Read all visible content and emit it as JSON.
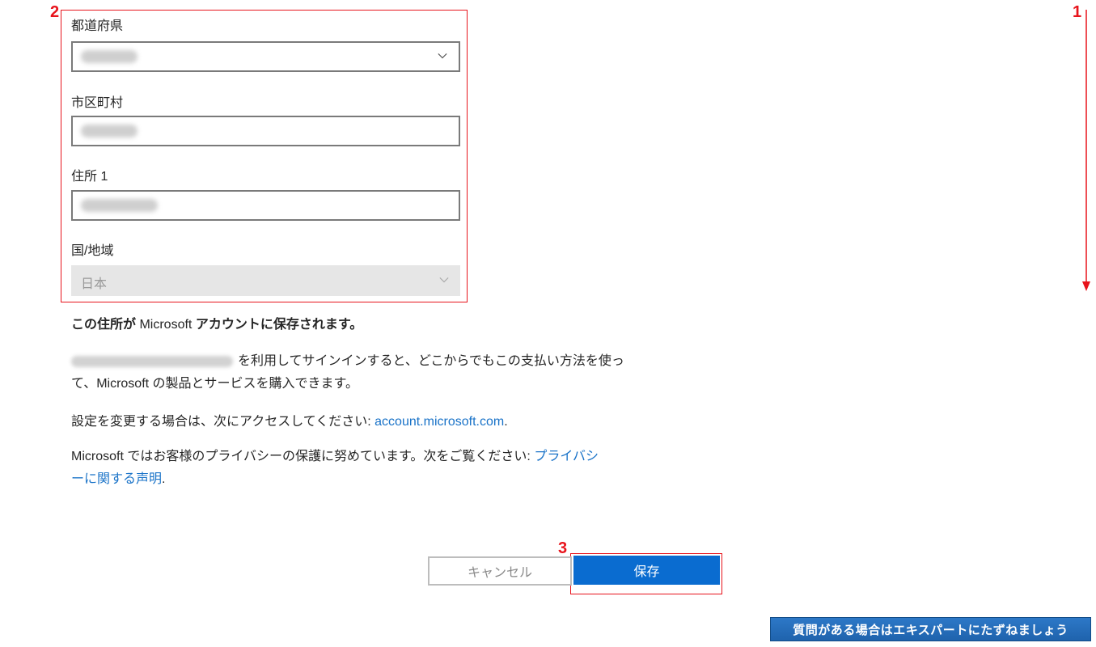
{
  "annotations": {
    "one": "1",
    "two": "2",
    "three": "3",
    "color": "#e8141c"
  },
  "form": {
    "prefecture_label": "都道府県",
    "city_label": "市区町村",
    "address1_label": "住所 1",
    "country_label": "国/地域",
    "country_value": "日本"
  },
  "info": {
    "heading_pre": "この住所が",
    "heading_ms": " Microsoft ",
    "heading_post": "アカウントに保存されます。",
    "signin_line1": "を利用してサインインすると、どこからでもこの支払い方法を使っ",
    "signin_line2": "て、Microsoft の製品とサービスを購入できます。",
    "settings_text": "設定を変更する場合は、次にアクセスしてください: ",
    "settings_link": "account.microsoft.com",
    "privacy_text": "Microsoft ではお客様のプライバシーの保護に努めています。次をご覧ください: ",
    "privacy_link_part1": "プライバシ",
    "privacy_link_part2": "ーに関する声明",
    "period": "."
  },
  "buttons": {
    "cancel": "キャンセル",
    "save": "保存"
  },
  "help": {
    "label": "質問がある場合はエキスパートにたずねましょう"
  },
  "colors": {
    "primary": "#0a6cd0",
    "link": "#1a73c8"
  }
}
